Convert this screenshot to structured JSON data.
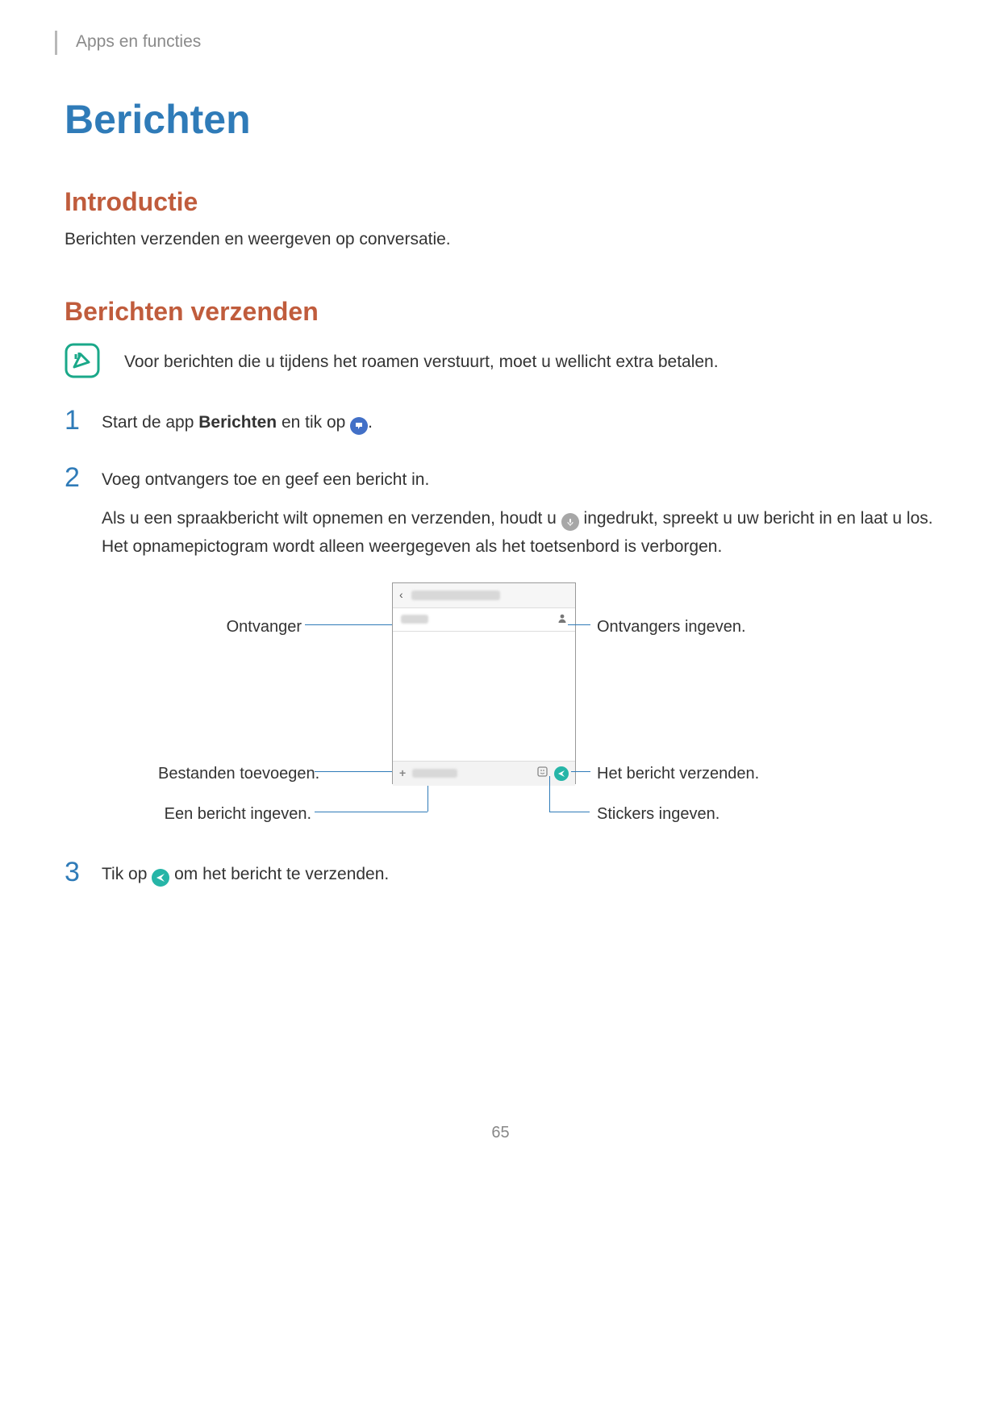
{
  "breadcrumb": "Apps en functies",
  "page_title": "Berichten",
  "section_intro": {
    "title": "Introductie",
    "body": "Berichten verzenden en weergeven op conversatie."
  },
  "section_send": {
    "title": "Berichten verzenden",
    "note": "Voor berichten die u tijdens het roamen verstuurt, moet u wellicht extra betalen.",
    "step1": {
      "pre": "Start de app ",
      "bold": "Berichten",
      "post": " en tik op ",
      "tail": "."
    },
    "step2": {
      "line1": "Voeg ontvangers toe en geef een bericht in.",
      "line2a": "Als u een spraakbericht wilt opnemen en verzenden, houdt u ",
      "line2b": " ingedrukt, spreekt u uw bericht in en laat u los. Het opnamepictogram wordt alleen weergegeven als het toetsenbord is verborgen."
    },
    "callouts": {
      "left_recipient": "Ontvanger",
      "left_attach": "Bestanden toevoegen.",
      "left_compose": "Een bericht ingeven.",
      "right_recipients": "Ontvangers ingeven.",
      "right_send": "Het bericht verzenden.",
      "right_stickers": "Stickers ingeven."
    },
    "step3": {
      "pre": "Tik op ",
      "post": " om het bericht te verzenden."
    }
  },
  "page_number": "65"
}
